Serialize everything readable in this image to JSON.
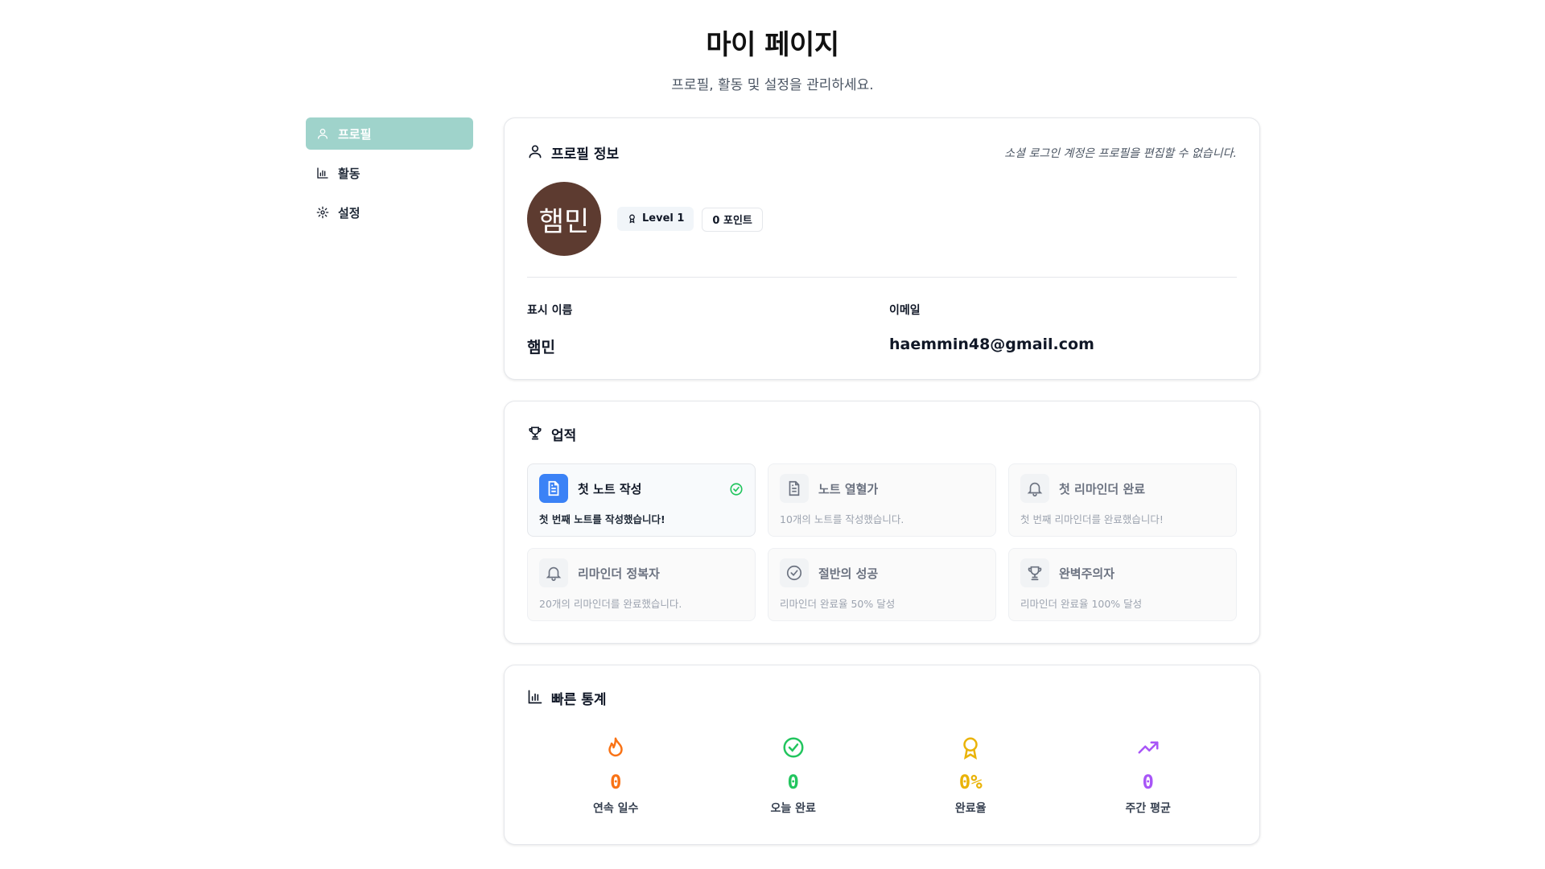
{
  "page": {
    "title": "마이 페이지",
    "subtitle": "프로필, 활동 및 설정을 관리하세요."
  },
  "sidebar": {
    "items": [
      {
        "label": "프로필",
        "icon": "user-icon",
        "active": true
      },
      {
        "label": "활동",
        "icon": "bar-chart-icon",
        "active": false
      },
      {
        "label": "설정",
        "icon": "gear-icon",
        "active": false
      }
    ],
    "active_color": "#9fd3cb"
  },
  "profile": {
    "title": "프로필 정보",
    "note": "소셜 로그인 계정은 프로필을 편집할 수 없습니다.",
    "avatar_text": "햄민",
    "avatar_color": "#5d3b30",
    "level_badge": "Level 1",
    "points_badge": "0 포인트",
    "display_name_label": "표시 이름",
    "display_name": "햄민",
    "email_label": "이메일",
    "email": "haemmin48@gmail.com"
  },
  "achievements": {
    "title": "업적",
    "items": [
      {
        "title": "첫 노트 작성",
        "desc": "첫 번째 노트를 작성했습니다!",
        "icon": "document-icon",
        "completed": true
      },
      {
        "title": "노트 열혈가",
        "desc": "10개의 노트를 작성했습니다.",
        "icon": "document-icon",
        "completed": false
      },
      {
        "title": "첫 리마인더 완료",
        "desc": "첫 번째 리마인더를 완료했습니다!",
        "icon": "bell-icon",
        "completed": false
      },
      {
        "title": "리마인더 정복자",
        "desc": "20개의 리마인더를 완료했습니다.",
        "icon": "bell-icon",
        "completed": false
      },
      {
        "title": "절반의 성공",
        "desc": "리마인더 완료율 50% 달성",
        "icon": "check-circle-icon",
        "completed": false
      },
      {
        "title": "완벽주의자",
        "desc": "리마인더 완료율 100% 달성",
        "icon": "trophy-icon",
        "completed": false
      }
    ]
  },
  "stats": {
    "title": "빠른 통계",
    "items": [
      {
        "value": "0",
        "label": "연속 일수",
        "icon": "flame-icon",
        "color": "#f97316"
      },
      {
        "value": "0",
        "label": "오늘 완료",
        "icon": "check-circle-icon",
        "color": "#22c55e"
      },
      {
        "value": "0%",
        "label": "완료율",
        "icon": "award-icon",
        "color": "#eab308"
      },
      {
        "value": "0",
        "label": "주간 평균",
        "icon": "trending-up-icon",
        "color": "#a855f7"
      }
    ]
  }
}
